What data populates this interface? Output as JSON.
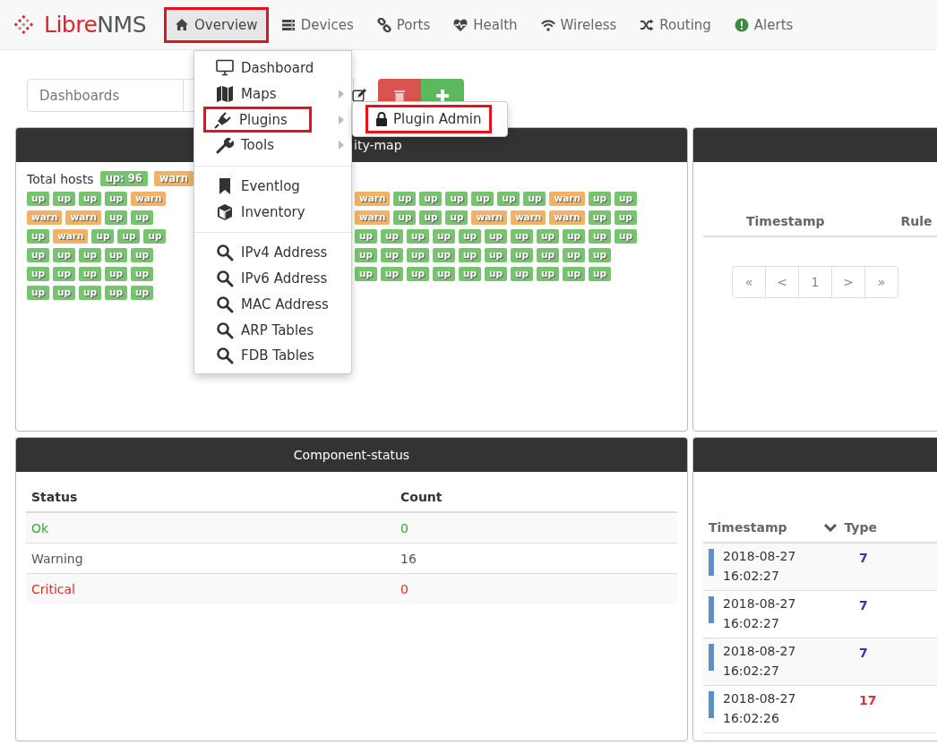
{
  "navbar": {
    "logo": {
      "first": "Libre",
      "second": "NMS"
    },
    "items": [
      {
        "label": "Overview",
        "selected": true,
        "annotated": true
      },
      {
        "label": "Devices",
        "selected": false,
        "annotated": false
      },
      {
        "label": "Ports",
        "selected": false,
        "annotated": false
      },
      {
        "label": "Health",
        "selected": false,
        "annotated": false
      },
      {
        "label": "Wireless",
        "selected": false,
        "annotated": false
      },
      {
        "label": "Routing",
        "selected": false,
        "annotated": false
      },
      {
        "label": "Alerts",
        "selected": false,
        "annotated": false
      }
    ]
  },
  "dashboard_bar": {
    "select": {
      "value": "Dashboards"
    }
  },
  "overview_menu": {
    "groups": [
      [
        {
          "label": "Dashboard",
          "submenu": false,
          "annotated": false
        },
        {
          "label": "Maps",
          "submenu": true,
          "annotated": false
        },
        {
          "label": "Plugins",
          "submenu": true,
          "annotated": true
        },
        {
          "label": "Tools",
          "submenu": true,
          "annotated": false
        }
      ],
      [
        {
          "label": "Eventlog",
          "submenu": false,
          "annotated": false
        },
        {
          "label": "Inventory",
          "submenu": false,
          "annotated": false
        }
      ],
      [
        {
          "label": "IPv4 Address",
          "submenu": false,
          "annotated": false
        },
        {
          "label": "IPv6 Address",
          "submenu": false,
          "annotated": false
        },
        {
          "label": "MAC Address",
          "submenu": false,
          "annotated": false
        },
        {
          "label": "ARP Tables",
          "submenu": false,
          "annotated": false
        },
        {
          "label": "FDB Tables",
          "submenu": false,
          "annotated": false
        }
      ]
    ],
    "submenu": {
      "items": [
        {
          "label": "Plugin Admin",
          "annotated": true
        }
      ]
    }
  },
  "availability_widget": {
    "title": "ity-map",
    "total_label": "Total hosts",
    "summary": [
      {
        "label": "up: 96",
        "color": "#77c36f"
      },
      {
        "label": "warn",
        "color": "#f0b264"
      }
    ],
    "rows": [
      {
        "left": [
          {
            "label": "up",
            "color": "#77c36f"
          },
          {
            "label": "up",
            "color": "#77c36f"
          },
          {
            "label": "up",
            "color": "#77c36f"
          },
          {
            "label": "up",
            "color": "#77c36f"
          },
          {
            "label": "warn",
            "color": "#f0b264"
          }
        ],
        "right": [
          {
            "label": "warn",
            "color": "#f0b264"
          },
          {
            "label": "up",
            "color": "#77c36f"
          },
          {
            "label": "up",
            "color": "#77c36f"
          },
          {
            "label": "up",
            "color": "#77c36f"
          },
          {
            "label": "up",
            "color": "#77c36f"
          },
          {
            "label": "up",
            "color": "#77c36f"
          },
          {
            "label": "up",
            "color": "#77c36f"
          },
          {
            "label": "warn",
            "color": "#f0b264"
          },
          {
            "label": "up",
            "color": "#77c36f"
          },
          {
            "label": "up",
            "color": "#77c36f"
          }
        ]
      },
      {
        "left": [
          {
            "label": "warn",
            "color": "#f0b264"
          },
          {
            "label": "warn",
            "color": "#f0b264"
          },
          {
            "label": "up",
            "color": "#77c36f"
          },
          {
            "label": "up",
            "color": "#77c36f"
          }
        ],
        "right": [
          {
            "label": "warn",
            "color": "#f0b264"
          },
          {
            "label": "up",
            "color": "#77c36f"
          },
          {
            "label": "up",
            "color": "#77c36f"
          },
          {
            "label": "up",
            "color": "#77c36f"
          },
          {
            "label": "warn",
            "color": "#f0b264"
          },
          {
            "label": "warn",
            "color": "#f0b264"
          },
          {
            "label": "warn",
            "color": "#f0b264"
          },
          {
            "label": "up",
            "color": "#77c36f"
          },
          {
            "label": "up",
            "color": "#77c36f"
          }
        ]
      },
      {
        "left": [
          {
            "label": "up",
            "color": "#77c36f"
          },
          {
            "label": "warn",
            "color": "#f0b264"
          },
          {
            "label": "up",
            "color": "#77c36f"
          },
          {
            "label": "up",
            "color": "#77c36f"
          },
          {
            "label": "up",
            "color": "#77c36f"
          }
        ],
        "right": [
          {
            "label": "up",
            "color": "#77c36f"
          },
          {
            "label": "up",
            "color": "#77c36f"
          },
          {
            "label": "up",
            "color": "#77c36f"
          },
          {
            "label": "up",
            "color": "#77c36f"
          },
          {
            "label": "up",
            "color": "#77c36f"
          },
          {
            "label": "up",
            "color": "#77c36f"
          },
          {
            "label": "up",
            "color": "#77c36f"
          },
          {
            "label": "up",
            "color": "#77c36f"
          },
          {
            "label": "up",
            "color": "#77c36f"
          },
          {
            "label": "up",
            "color": "#77c36f"
          },
          {
            "label": "up",
            "color": "#77c36f"
          }
        ]
      },
      {
        "left": [
          {
            "label": "up",
            "color": "#77c36f"
          },
          {
            "label": "up",
            "color": "#77c36f"
          },
          {
            "label": "up",
            "color": "#77c36f"
          },
          {
            "label": "up",
            "color": "#77c36f"
          },
          {
            "label": "up",
            "color": "#77c36f"
          }
        ],
        "right": [
          {
            "label": "up",
            "color": "#77c36f"
          },
          {
            "label": "up",
            "color": "#77c36f"
          },
          {
            "label": "up",
            "color": "#77c36f"
          },
          {
            "label": "up",
            "color": "#77c36f"
          },
          {
            "label": "up",
            "color": "#77c36f"
          },
          {
            "label": "up",
            "color": "#77c36f"
          },
          {
            "label": "up",
            "color": "#77c36f"
          },
          {
            "label": "up",
            "color": "#77c36f"
          },
          {
            "label": "up",
            "color": "#77c36f"
          },
          {
            "label": "up",
            "color": "#77c36f"
          }
        ]
      },
      {
        "left": [
          {
            "label": "up",
            "color": "#77c36f"
          },
          {
            "label": "up",
            "color": "#77c36f"
          },
          {
            "label": "up",
            "color": "#77c36f"
          },
          {
            "label": "up",
            "color": "#77c36f"
          },
          {
            "label": "up",
            "color": "#77c36f"
          }
        ],
        "right": [
          {
            "label": "up",
            "color": "#77c36f"
          },
          {
            "label": "up",
            "color": "#77c36f"
          },
          {
            "label": "up",
            "color": "#77c36f"
          },
          {
            "label": "up",
            "color": "#77c36f"
          },
          {
            "label": "up",
            "color": "#77c36f"
          },
          {
            "label": "up",
            "color": "#77c36f"
          },
          {
            "label": "up",
            "color": "#77c36f"
          },
          {
            "label": "up",
            "color": "#77c36f"
          },
          {
            "label": "up",
            "color": "#77c36f"
          },
          {
            "label": "up",
            "color": "#77c36f"
          }
        ]
      },
      {
        "left": [
          {
            "label": "up",
            "color": "#77c36f"
          },
          {
            "label": "up",
            "color": "#77c36f"
          },
          {
            "label": "up",
            "color": "#77c36f"
          },
          {
            "label": "up",
            "color": "#77c36f"
          },
          {
            "label": "up",
            "color": "#77c36f"
          }
        ]
      }
    ]
  },
  "alerts_widget": {
    "columns": [
      "Timestamp",
      "Rule"
    ],
    "pagination": [
      "«",
      "<",
      "1",
      ">",
      "»"
    ]
  },
  "component_widget": {
    "title": "Component-status",
    "columns": [
      "Status",
      "Count"
    ],
    "rows": [
      {
        "status": "Ok",
        "count": "0",
        "kind": "ok"
      },
      {
        "status": "Warning",
        "count": "16",
        "kind": "warning"
      },
      {
        "status": "Critical",
        "count": "0",
        "kind": "critical"
      }
    ]
  },
  "eventlog_widget": {
    "columns": [
      "Timestamp",
      "Type"
    ],
    "rows": [
      {
        "timestamp": "2018-08-27 16:02:27",
        "type": "7",
        "color": "#3636a8"
      },
      {
        "timestamp": "2018-08-27 16:02:27",
        "type": "7",
        "color": "#3636a8"
      },
      {
        "timestamp": "2018-08-27 16:02:27",
        "type": "7",
        "color": "#3636a8"
      },
      {
        "timestamp": "2018-08-27 16:02:26",
        "type": "17",
        "color": "#d9352c"
      }
    ]
  }
}
